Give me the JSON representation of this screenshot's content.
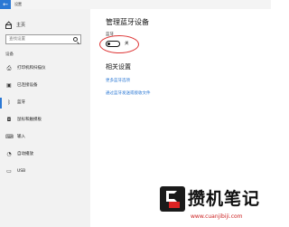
{
  "window": {
    "title": "设置",
    "back_glyph": "←"
  },
  "sidebar": {
    "home_label": "主页",
    "search_placeholder": "查找设置",
    "section_label": "设备",
    "items": [
      {
        "label": "打印机和扫描仪",
        "icon": "printer-icon",
        "glyph": "⎙"
      },
      {
        "label": "已连接设备",
        "icon": "devices-icon",
        "glyph": "▣"
      },
      {
        "label": "蓝牙",
        "icon": "bluetooth-icon",
        "glyph": "ᛒ"
      },
      {
        "label": "鼠标和触摸板",
        "icon": "mouse-icon",
        "glyph": "◘"
      },
      {
        "label": "输入",
        "icon": "keyboard-icon",
        "glyph": "⌨"
      },
      {
        "label": "自动播放",
        "icon": "autoplay-icon",
        "glyph": "◔"
      },
      {
        "label": "USB",
        "icon": "usb-icon",
        "glyph": "▭"
      }
    ],
    "active_index": 2
  },
  "main": {
    "title": "管理蓝牙设备",
    "bluetooth_label": "蓝牙",
    "toggle_state_label": "关",
    "toggle_on": false,
    "related_title": "相关设置",
    "links": [
      "更多蓝牙选项",
      "通过蓝牙发送或接收文件"
    ]
  },
  "watermark": {
    "text": "攒机笔记",
    "url": "www.cuanjibiji.com"
  },
  "colors": {
    "accent": "#2b78d4",
    "highlight_circle": "#dd3333"
  }
}
